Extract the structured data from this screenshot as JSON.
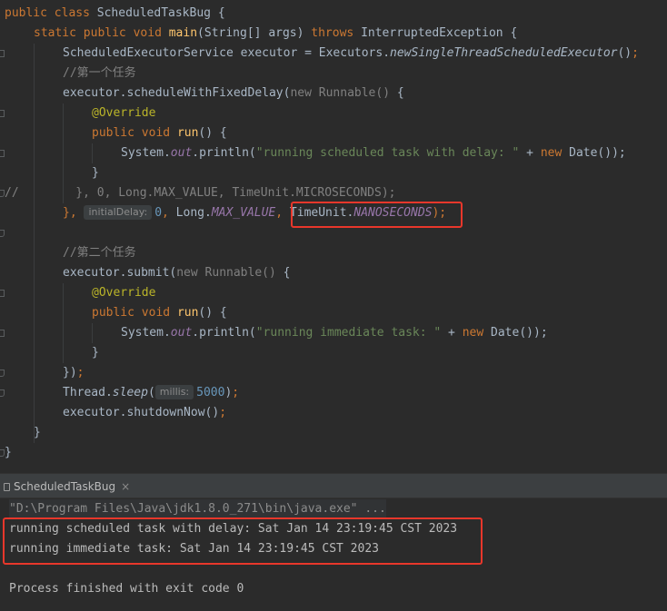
{
  "code": {
    "l1": {
      "kw1": "public",
      "kw2": "class",
      "cls": "ScheduledTaskBug",
      "brace": "{"
    },
    "l2": {
      "kw1": "static",
      "kw2": "public",
      "kw3": "void",
      "fn": "main",
      "params": "(String[] args)",
      "kw4": "throws",
      "exc": "InterruptedException {"
    },
    "l3": {
      "pre": "ScheduledExecutorService executor = Executors.",
      "call": "newSingleThreadScheduledExecutor",
      "post": "()",
      "semi": ";"
    },
    "l4": {
      "comment": "//第一个任务"
    },
    "l5": {
      "pre": "executor.scheduleWithFixedDelay(",
      "kw": "new",
      "type": "Runnable()",
      "post": " {"
    },
    "l6": {
      "annot": "@Override"
    },
    "l7": {
      "kw1": "public",
      "kw2": "void",
      "fn": "run",
      "post": "() {"
    },
    "l8": {
      "pre": "System.",
      "field": "out",
      "mid": ".println(",
      "str": "\"running scheduled task with delay: \"",
      "plus": " + ",
      "kw": "new",
      "post": " Date());"
    },
    "l9": {
      "brace": "}"
    },
    "l10": {
      "comment": "//        }, 0, Long.MAX_VALUE, TimeUnit.MICROSECONDS);"
    },
    "l11": {
      "pre": "}, ",
      "hint": "initialDelay:",
      "num": "0",
      "comma": ",",
      "long": " Long.",
      "maxval": "MAX_VALUE",
      "comma2": ",",
      "tu": "TimeUnit.",
      "nano": "NANOSECONDS",
      "end": ");"
    },
    "l13": {
      "comment": "//第二个任务"
    },
    "l14": {
      "pre": "executor.submit(",
      "kw": "new",
      "type": "Runnable()",
      "post": " {"
    },
    "l15": {
      "annot": "@Override"
    },
    "l16": {
      "kw1": "public",
      "kw2": "void",
      "fn": "run",
      "post": "() {"
    },
    "l17": {
      "pre": "System.",
      "field": "out",
      "mid": ".println(",
      "str": "\"running immediate task: \"",
      "plus": " + ",
      "kw": "new",
      "post": " Date());"
    },
    "l18": {
      "brace": "}"
    },
    "l19": {
      "pre": "})",
      "semi": ";"
    },
    "l20": {
      "pre": "Thread.",
      "call": "sleep",
      "paren": "(",
      "hint": "millis:",
      "num": "5000",
      "end": ")",
      "semi": ";"
    },
    "l21": {
      "pre": "executor.shutdownNow()",
      "semi": ";"
    },
    "l22": {
      "brace": "}"
    },
    "l23": {
      "brace": "}"
    }
  },
  "run_panel": {
    "tab_label": "ScheduledTaskBug",
    "close_glyph": "×"
  },
  "console": {
    "command": "\"D:\\Program Files\\Java\\jdk1.8.0_271\\bin\\java.exe\" ...",
    "out1": "running scheduled task with delay: Sat Jan 14 23:19:45 CST 2023",
    "out2": "running immediate task: Sat Jan 14 23:19:45 CST 2023",
    "finish": "Process finished with exit code 0"
  },
  "colors": {
    "highlight_box": "#e8372b",
    "background": "#2b2b2b"
  }
}
